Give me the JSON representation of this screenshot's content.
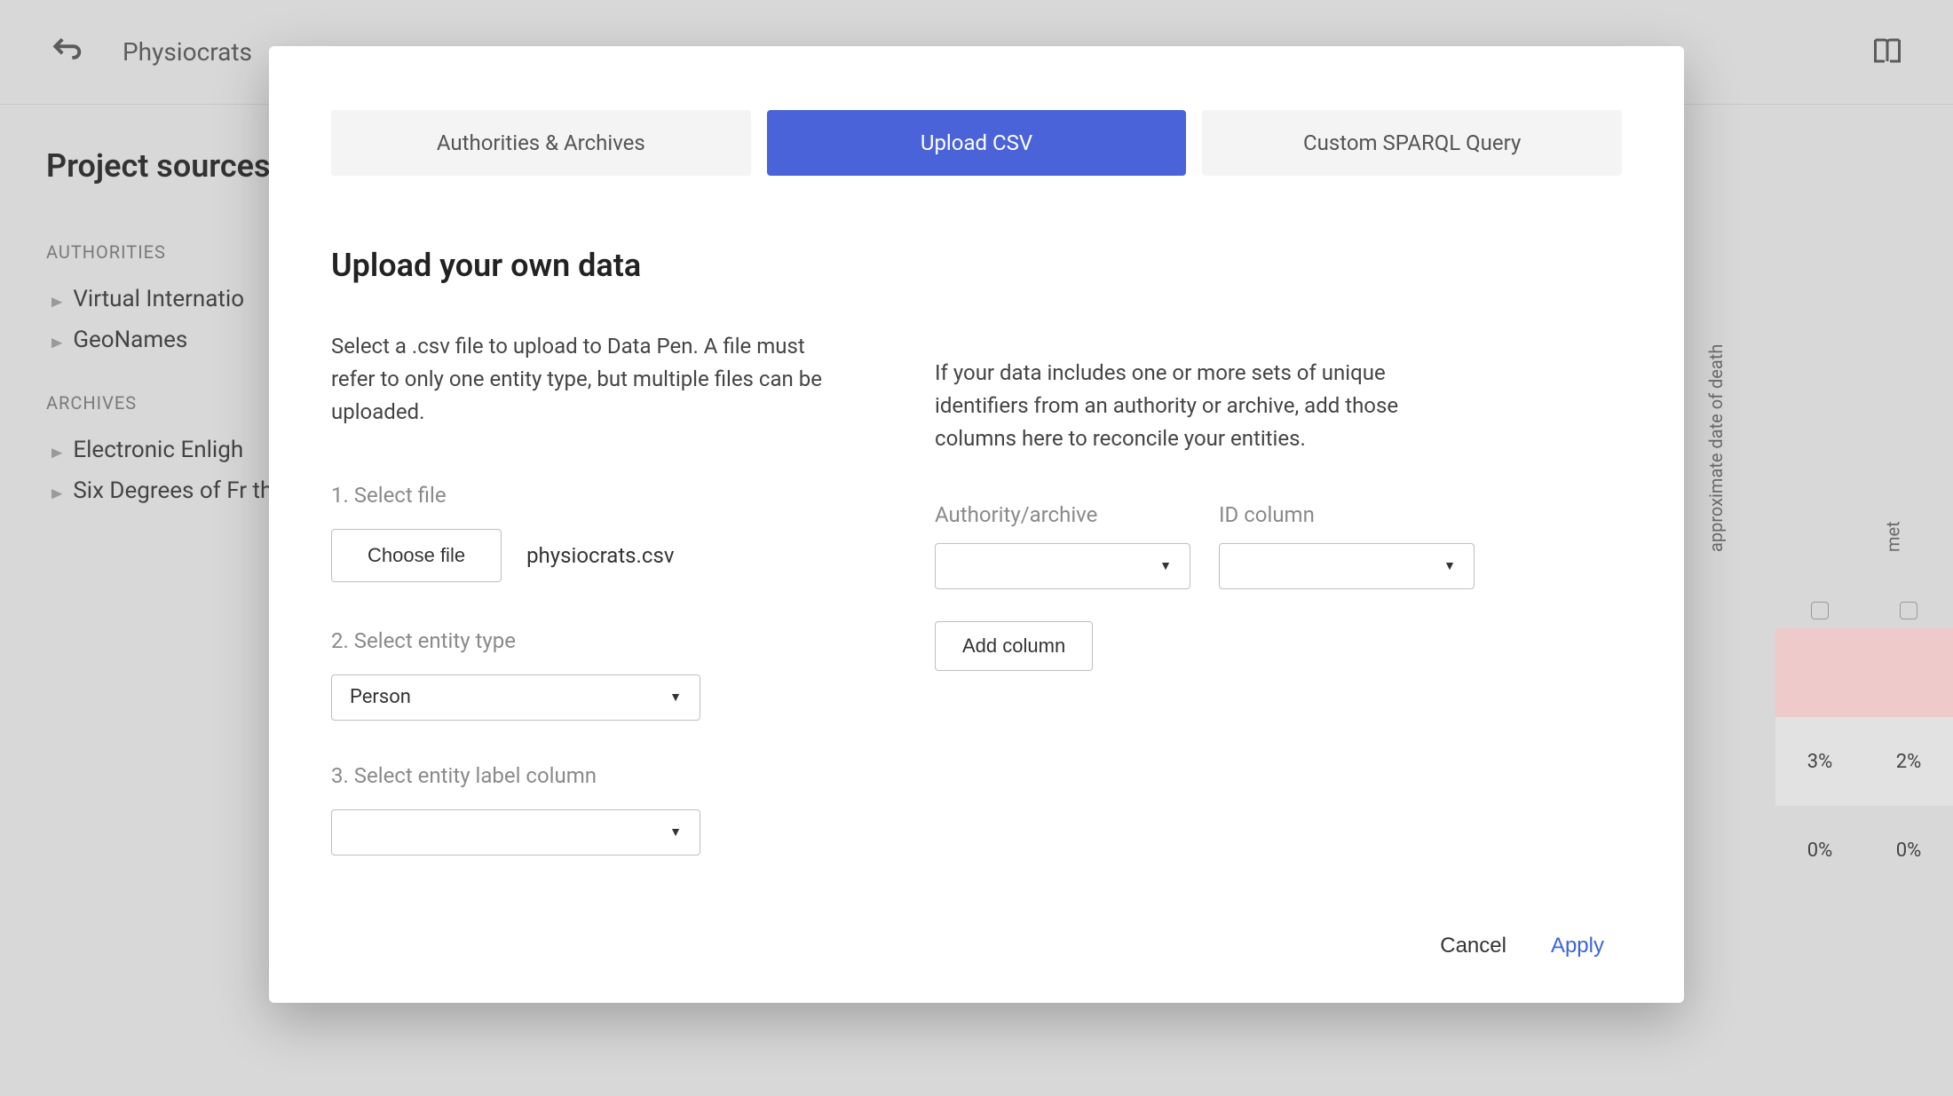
{
  "topbar": {
    "breadcrumb": "Physiocrats"
  },
  "sidebar": {
    "title": "Project sources",
    "sections": [
      {
        "label": "Authorities",
        "items": [
          "Virtual Internatio",
          "GeoNames"
        ]
      },
      {
        "label": "Archives",
        "items": [
          "Electronic Enligh",
          "Six Degrees of Fr the Early Modern"
        ]
      }
    ]
  },
  "tableBg": {
    "columns": [
      {
        "header": "approximate date of death",
        "cells": [
          "",
          "3%",
          "0%"
        ]
      },
      {
        "header": "met",
        "cells": [
          "",
          "2%",
          "0%"
        ]
      }
    ]
  },
  "modal": {
    "tabs": [
      {
        "label": "Authorities & Archives",
        "active": false
      },
      {
        "label": "Upload CSV",
        "active": true
      },
      {
        "label": "Custom SPARQL Query",
        "active": false
      }
    ],
    "heading": "Upload your own data",
    "description": "Select a .csv file to upload to Data Pen. A file must refer to only one entity type, but multiple files can be uploaded.",
    "step1": "1. Select file",
    "chooseFile": "Choose file",
    "filename": "physiocrats.csv",
    "step2": "2. Select entity type",
    "entityType": "Person",
    "step3": "3. Select entity label column",
    "entityLabel": "",
    "rightDesc": "If your data includes one or more sets of unique identifiers from an authority or archive, add those columns here to reconcile your entities.",
    "authLabel": "Authority/archive",
    "idLabel": "ID column",
    "authValue": "",
    "idValue": "",
    "addColumn": "Add column",
    "cancel": "Cancel",
    "apply": "Apply"
  }
}
